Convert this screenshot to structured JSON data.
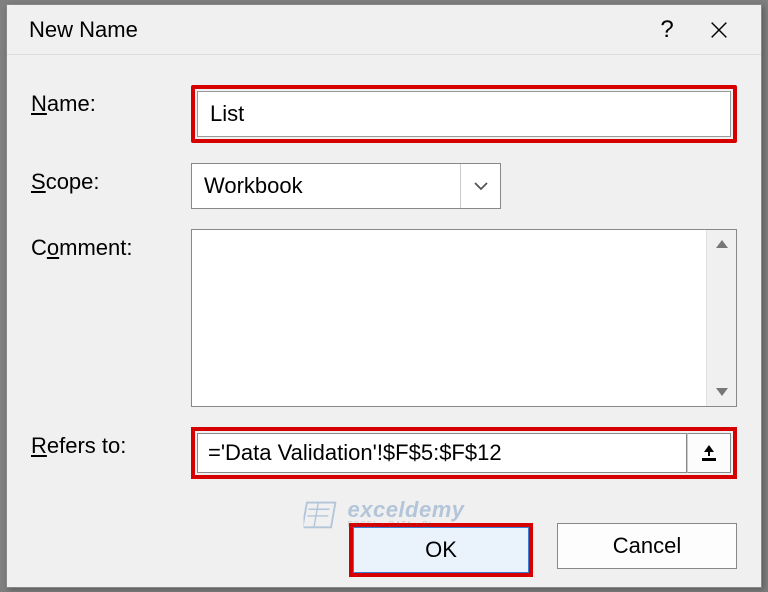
{
  "dialog": {
    "title": "New Name",
    "labels": {
      "name": "Name:",
      "scope": "Scope:",
      "comment": "Comment:",
      "refers_to": "Refers to:"
    },
    "fields": {
      "name_value": "List",
      "scope_value": "Workbook",
      "comment_value": "",
      "refers_to_value": "='Data Validation'!$F$5:$F$12"
    },
    "buttons": {
      "ok": "OK",
      "cancel": "Cancel"
    }
  },
  "watermark": {
    "brand": "exceldemy",
    "tagline": "EXCEL • DATA • BI"
  }
}
